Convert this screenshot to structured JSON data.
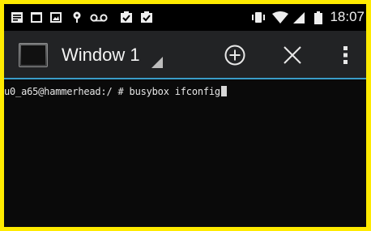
{
  "status_bar": {
    "notification_icons": [
      "notes-icon",
      "terminal-icon",
      "image-icon",
      "location-pin-icon",
      "voicemail-icon",
      "task-icon",
      "task-icon"
    ],
    "system_icons": [
      "vibrate-icon",
      "wifi-icon",
      "signal-icon",
      "battery-icon"
    ],
    "time": "18:07"
  },
  "action_bar": {
    "app_icon": "terminal-emulator-icon",
    "window_title": "Window 1",
    "new_window_icon": "add-circle-icon",
    "close_window_icon": "close-icon",
    "overflow_icon": "more-vert-icon",
    "accent_color": "#3a9cc8"
  },
  "terminal": {
    "prompt": "u0_a65@hammerhead:/ # ",
    "command": "busybox ifconfig"
  }
}
